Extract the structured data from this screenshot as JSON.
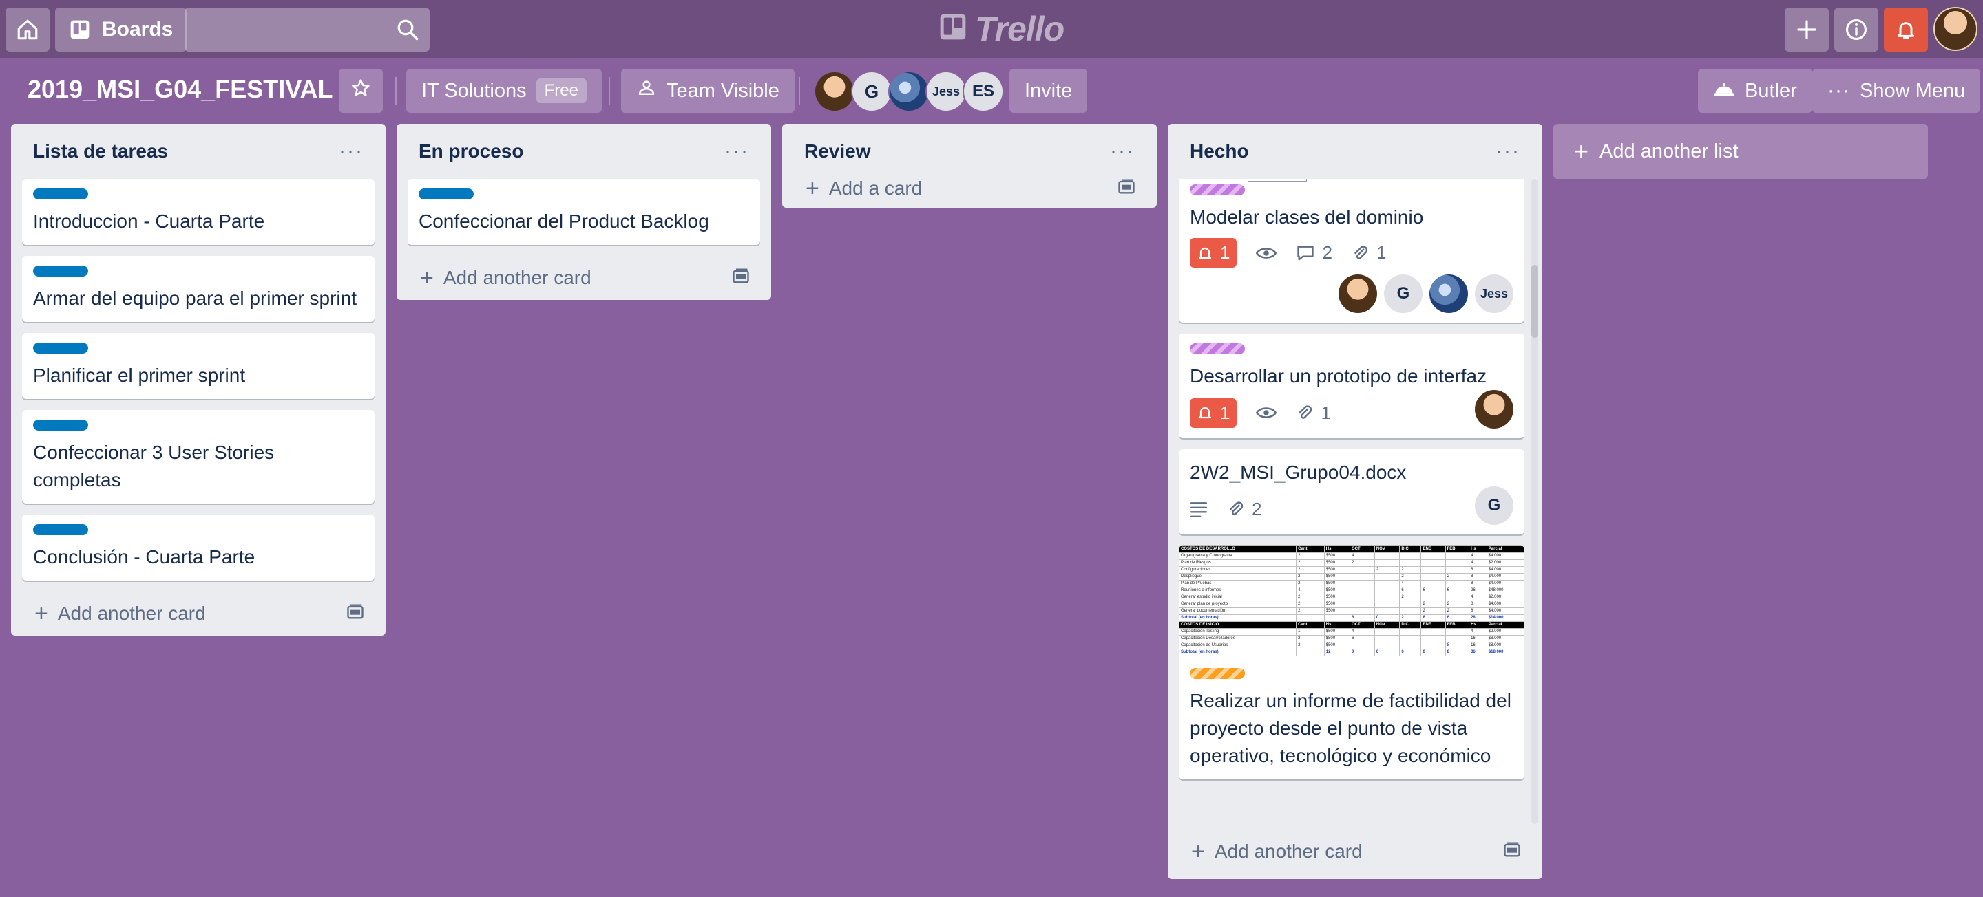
{
  "header": {
    "boards_label": "Boards",
    "search_placeholder": "",
    "logo_text": "Trello"
  },
  "board": {
    "title": "2019_MSI_G04_FESTIVAL",
    "team_name": "IT Solutions",
    "team_plan": "Free",
    "visibility": "Team Visible",
    "members": [
      "",
      "G",
      "",
      "Jess",
      "ES"
    ],
    "invite_label": "Invite",
    "butler_label": "Butler",
    "show_menu_label": "Show Menu"
  },
  "lists": [
    {
      "title": "Lista de tareas",
      "cards": [
        "Introduccion - Cuarta Parte",
        "Armar del equipo para el primer sprint",
        "Planificar el primer sprint",
        "Confeccionar 3 User Stories completas",
        "Conclusión - Cuarta Parte"
      ],
      "add_label": "Add another card"
    },
    {
      "title": "En proceso",
      "cards": [
        "Confeccionar del Product Backlog"
      ],
      "add_label": "Add another card"
    },
    {
      "title": "Review",
      "cards": [],
      "add_label": "Add a card"
    },
    {
      "title": "Hecho",
      "add_label": "Add another card",
      "cards": [
        {
          "title": "Modelar clases del dominio",
          "due_count": "1",
          "comments": "2",
          "attachments": "1",
          "members": [
            "",
            "G",
            "",
            "Jess"
          ]
        },
        {
          "title": "Desarrollar un prototipo de interfaz",
          "due_count": "1",
          "attachments": "1"
        },
        {
          "title": "2W2_MSI_Grupo04.docx",
          "attachments": "2",
          "members": [
            "G"
          ]
        },
        {
          "title": "Realizar un informe de factibilidad del proyecto desde el punto de vista operativo, tecnológico y económico"
        }
      ]
    }
  ],
  "add_list_label": "Add another list",
  "colors": {
    "background": "#89609e",
    "topbar": "#6e4e7f",
    "label_blue": "#0079bf",
    "badge_red": "#eb5a46"
  }
}
